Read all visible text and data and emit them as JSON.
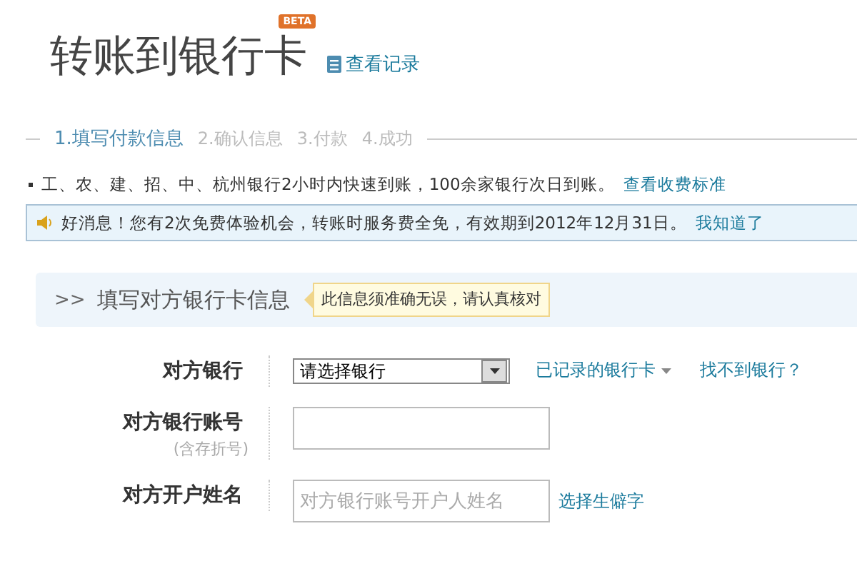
{
  "header": {
    "title": "转账到银行卡",
    "badge": "BETA",
    "history_link": "查看记录"
  },
  "steps": [
    {
      "label": "1.填写付款信息",
      "selected": true
    },
    {
      "label": "2.确认信息",
      "selected": false
    },
    {
      "label": "3.付款",
      "selected": false
    },
    {
      "label": "4.成功",
      "selected": false
    }
  ],
  "info": {
    "text": "工、农、建、招、中、杭州银行2小时内快速到账，100余家银行次日到账。",
    "link": "查看收费标准"
  },
  "notice": {
    "text": "好消息！您有2次免费体验机会，转账时服务费全免，有效期到2012年12月31日。",
    "link": "我知道了"
  },
  "section": {
    "arrow": ">>",
    "title": "填写对方银行卡信息",
    "tip": "此信息须准确无误，请认真核对"
  },
  "form": [
    {
      "kind": "select",
      "label": "对方银行",
      "value": "请选择银行",
      "links": [
        "已记录的银行卡",
        "找不到银行？"
      ]
    },
    {
      "kind": "input",
      "label": "对方银行账号",
      "sublabel": "(含存折号)"
    },
    {
      "kind": "input",
      "label": "对方开户姓名",
      "placeholder": "对方银行账号开户人姓名",
      "links": [
        "选择生僻字"
      ]
    }
  ]
}
